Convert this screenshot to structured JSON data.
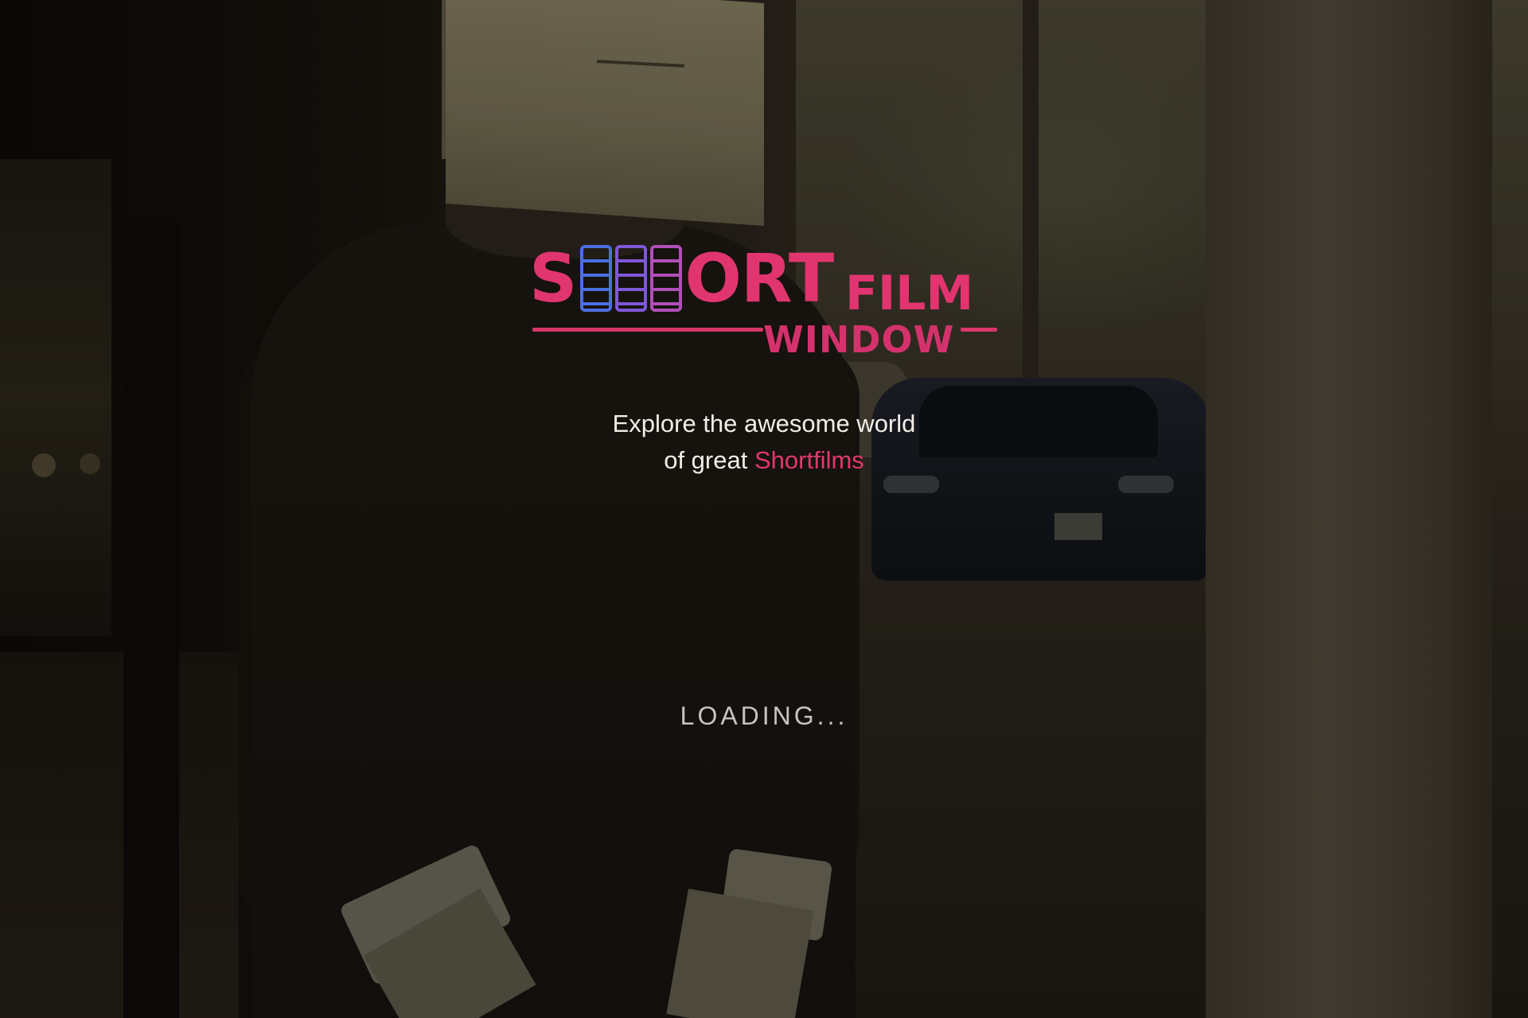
{
  "brand": {
    "logo_text_short_start": "S",
    "logo_text_short_end": "ORT",
    "logo_text_film": "FILM",
    "logo_text_window": "WINDOW",
    "colors": {
      "pink": "#e0356f",
      "blue": "#4a6fe0",
      "purple": "#7f57d8"
    },
    "reel_icon": "film-reel-icon"
  },
  "tagline": {
    "line1": "Explore the awesome world",
    "line2_prefix": "of great ",
    "line2_accent": "Shortfilms"
  },
  "status": {
    "loading_text": "LOADING..."
  },
  "background": {
    "subject": "person with cardboard box head on a street"
  }
}
